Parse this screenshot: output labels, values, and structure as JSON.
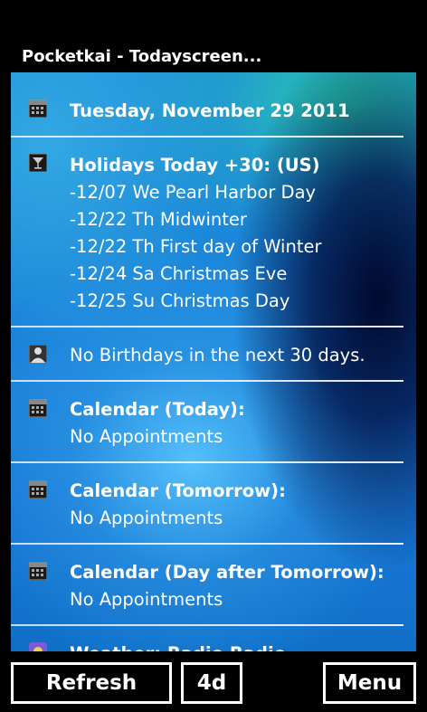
{
  "app": {
    "title": "Pocketkai - Todayscreen..."
  },
  "sections": {
    "date": {
      "icon": "calendar-icon",
      "text": "Tuesday, November 29 2011"
    },
    "holidays": {
      "icon": "martini-glass-icon",
      "heading": "Holidays Today +30: (US)",
      "items": [
        "-12/07 We Pearl Harbor Day",
        "-12/22 Th Midwinter",
        "-12/22 Th First day of Winter",
        "-12/24 Sa Christmas Eve",
        "-12/25 Su Christmas Day"
      ]
    },
    "birthdays": {
      "icon": "person-icon",
      "text": "No Birthdays in the next 30 days."
    },
    "calendar_today": {
      "icon": "calendar-icon",
      "heading": "Calendar (Today):",
      "text": "No Appointments"
    },
    "calendar_tomorrow": {
      "icon": "calendar-icon",
      "heading": "Calendar (Tomorrow):",
      "text": "No Appointments"
    },
    "calendar_day_after": {
      "icon": "calendar-icon",
      "heading": "Calendar (Day after Tomorrow):",
      "text": "No Appointments"
    },
    "weather_partial": {
      "icon": "weather-icon",
      "heading": "Weather: Radio Radio"
    }
  },
  "appbar": {
    "refresh_label": "Refresh",
    "range_label": "4d",
    "menu_label": "Menu"
  }
}
